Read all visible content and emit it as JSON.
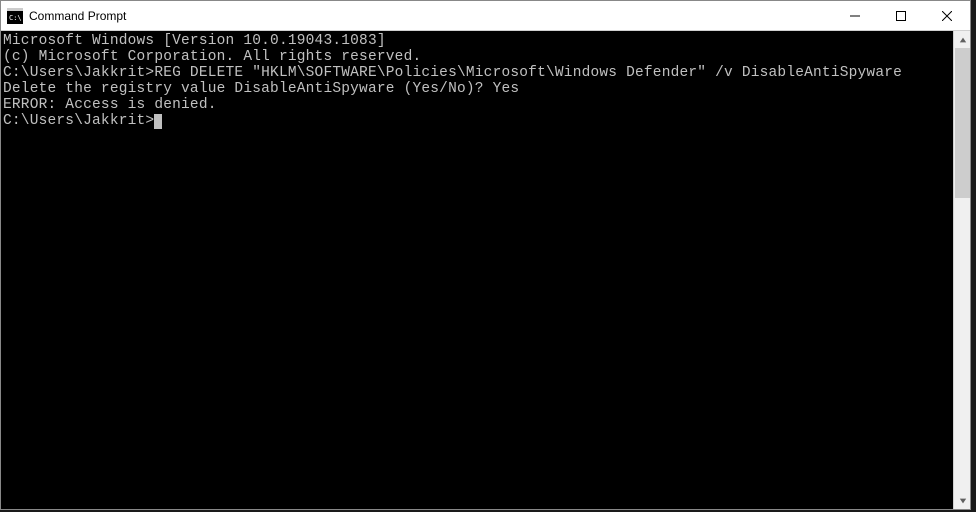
{
  "titlebar": {
    "title": "Command Prompt"
  },
  "terminal": {
    "line1": "Microsoft Windows [Version 10.0.19043.1083]",
    "line2": "(c) Microsoft Corporation. All rights reserved.",
    "line3": "",
    "line4": "C:\\Users\\Jakkrit>REG DELETE \"HKLM\\SOFTWARE\\Policies\\Microsoft\\Windows Defender\" /v DisableAntiSpyware",
    "line5": "Delete the registry value DisableAntiSpyware (Yes/No)? Yes",
    "line6": "ERROR: Access is denied.",
    "line7": "",
    "line8": "C:\\Users\\Jakkrit>"
  }
}
